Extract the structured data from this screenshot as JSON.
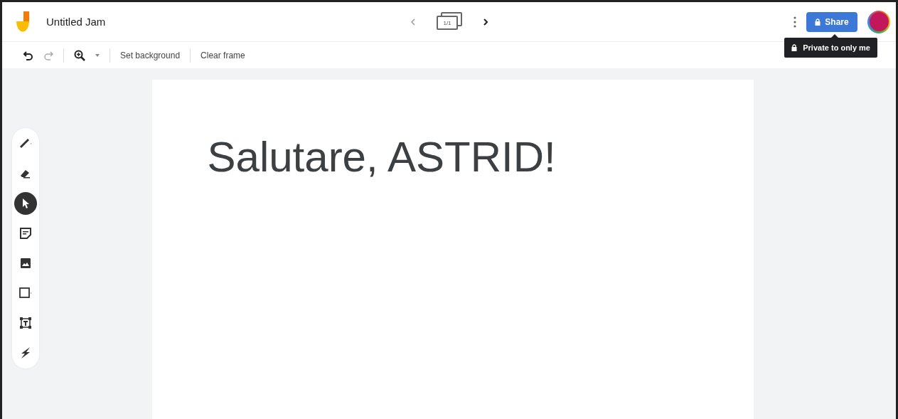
{
  "window": {
    "title": "Untitled Jam"
  },
  "frame_nav": {
    "counter": "1/1"
  },
  "share": {
    "label": "Share",
    "tooltip": "Private to only me"
  },
  "toolbar": {
    "actions": [
      "Set background",
      "Clear frame"
    ]
  },
  "tools": [
    {
      "kind": "pen",
      "selected": false
    },
    {
      "kind": "eraser",
      "selected": false
    },
    {
      "kind": "select",
      "selected": true
    },
    {
      "kind": "note",
      "selected": false
    },
    {
      "kind": "image",
      "selected": false
    },
    {
      "kind": "shape",
      "selected": false
    },
    {
      "kind": "textbox",
      "selected": false
    },
    {
      "kind": "laser",
      "selected": false
    }
  ],
  "frame": {
    "text": "Salutare, ASTRID!"
  }
}
